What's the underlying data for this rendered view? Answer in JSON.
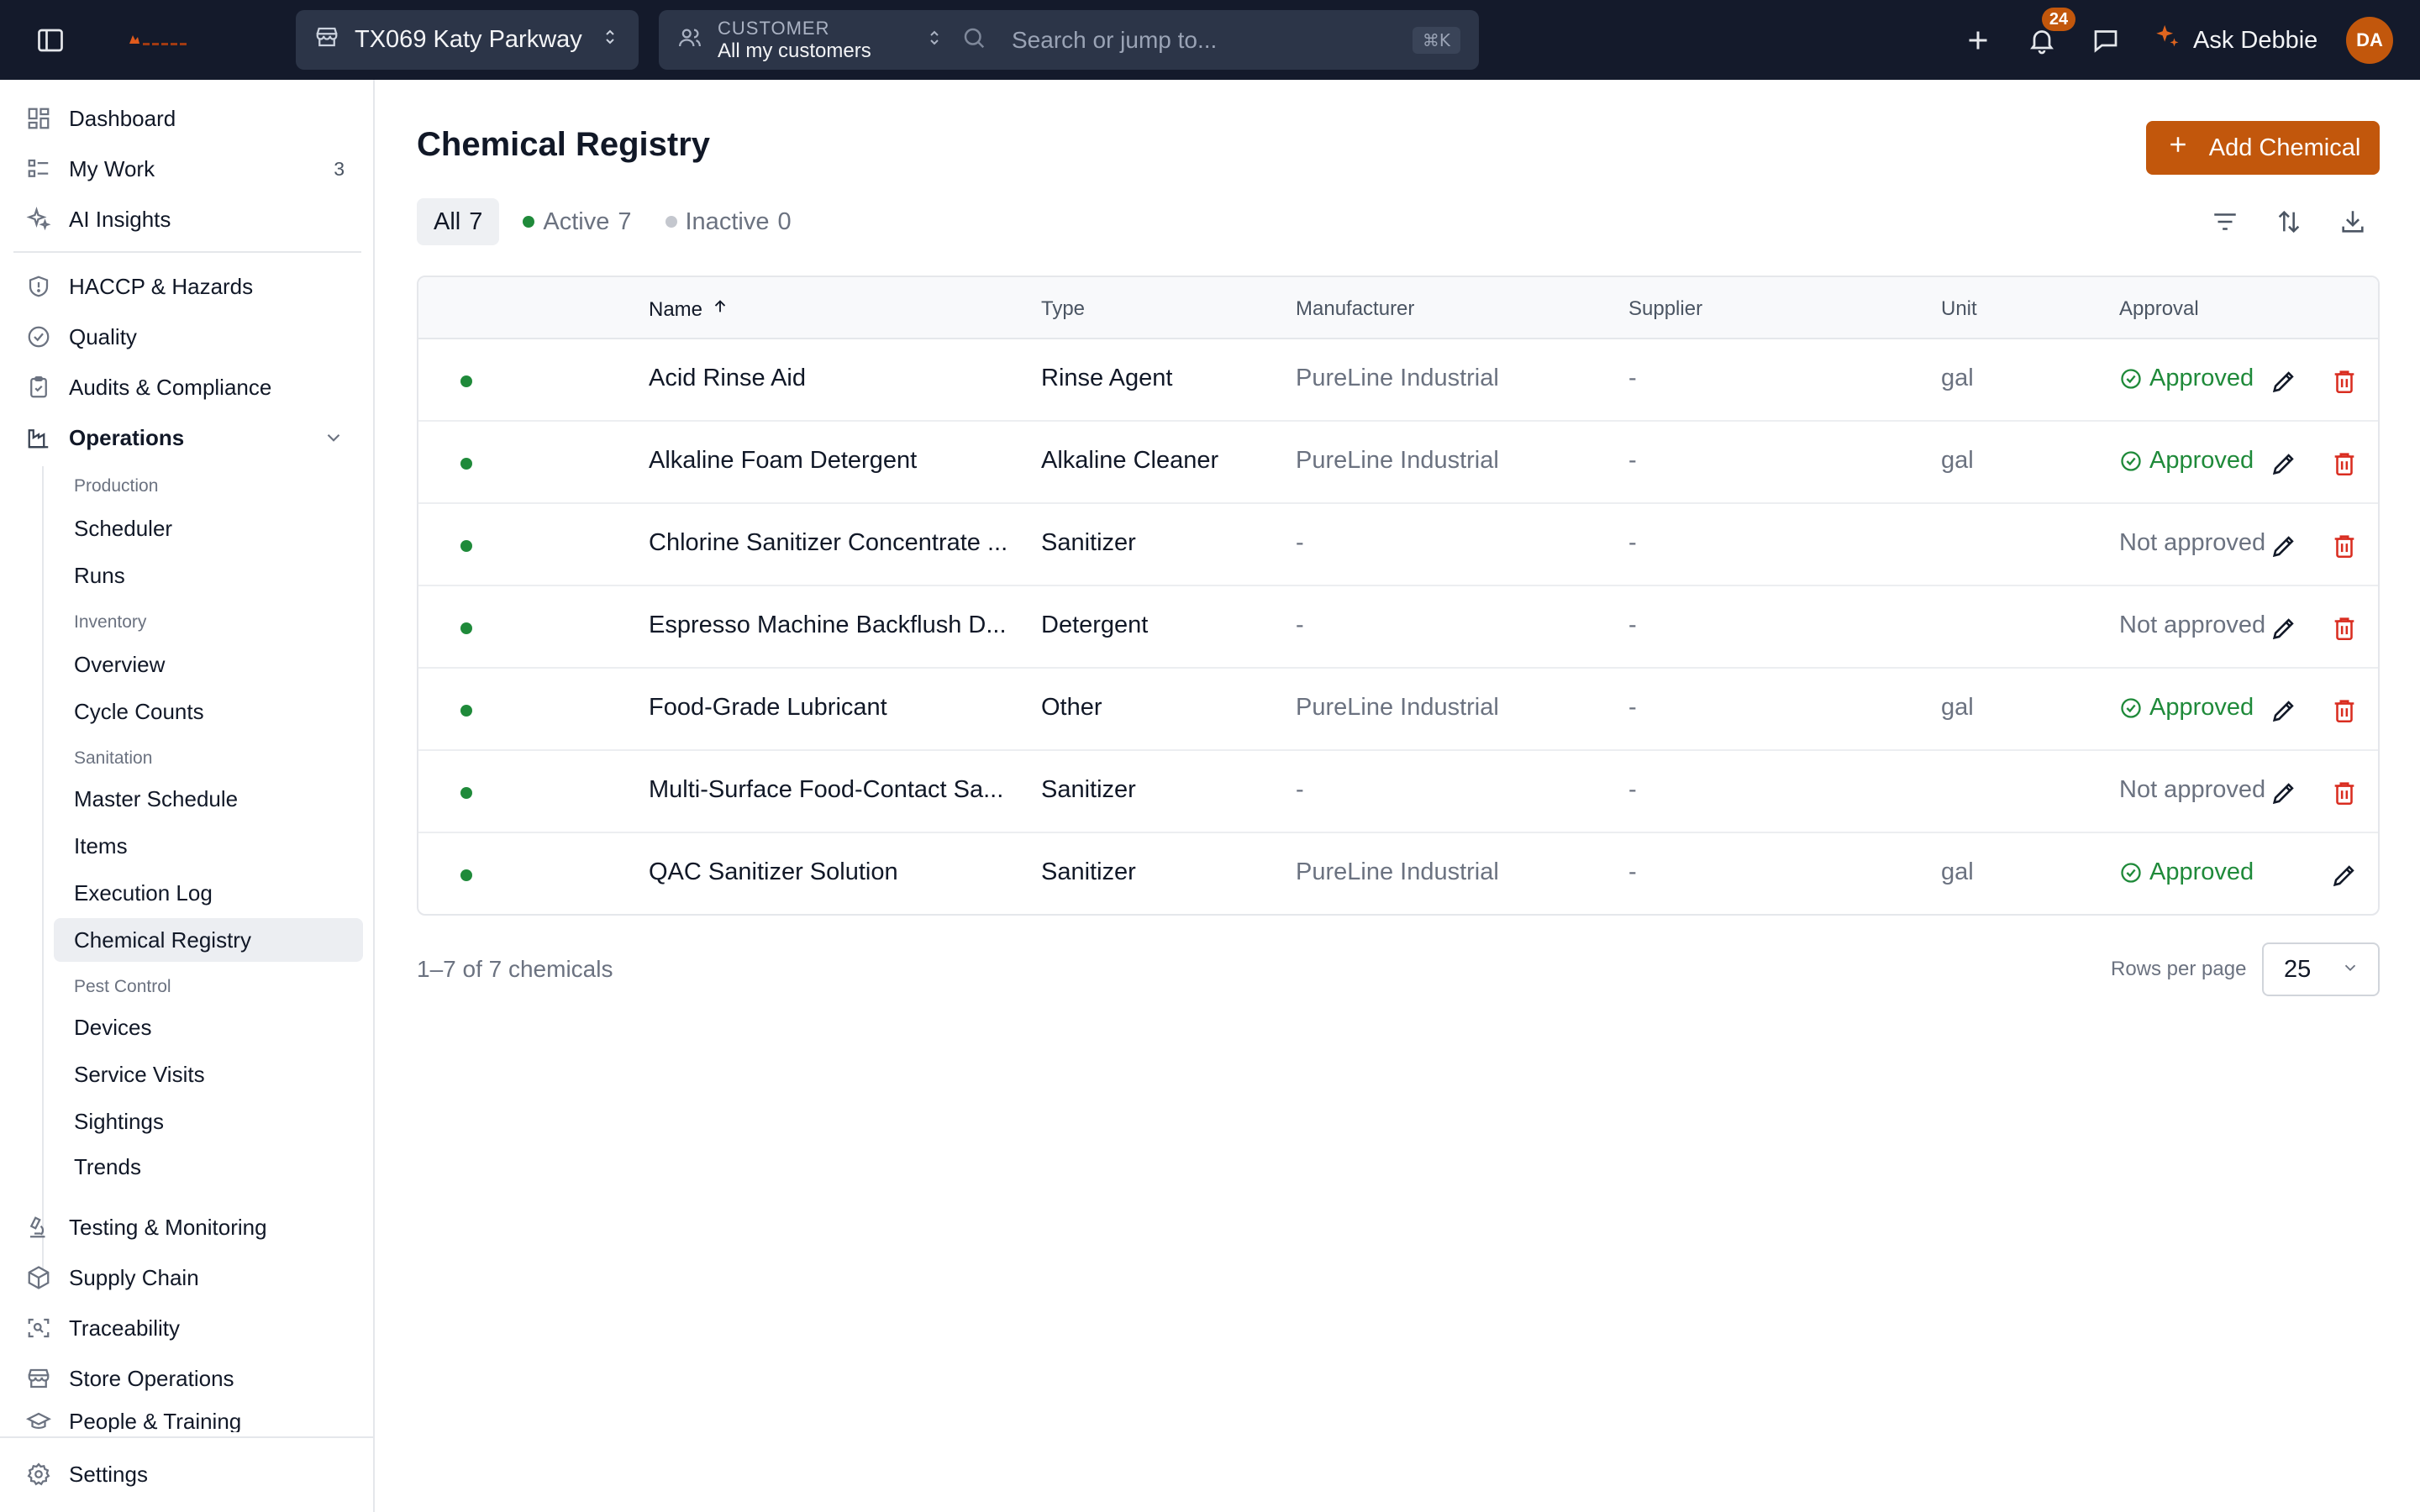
{
  "topbar": {
    "location": "TX069 Katy Parkway",
    "customer_caption": "CUSTOMER",
    "customer_value": "All my customers",
    "search_placeholder": "Search or jump to...",
    "search_shortcut": "⌘K",
    "notifications_count": "24",
    "ask_label": "Ask Debbie",
    "avatar_initials": "DA"
  },
  "sidebar": {
    "top_items": [
      {
        "label": "Dashboard",
        "icon": "dashboard-icon"
      },
      {
        "label": "My Work",
        "icon": "list-icon",
        "count": "3"
      },
      {
        "label": "AI Insights",
        "icon": "sparkle-icon"
      }
    ],
    "sections": [
      {
        "label": "HACCP & Hazards",
        "icon": "shield-icon"
      },
      {
        "label": "Quality",
        "icon": "check-circle-icon"
      },
      {
        "label": "Audits & Compliance",
        "icon": "clipboard-icon"
      },
      {
        "label": "Operations",
        "icon": "factory-icon"
      }
    ],
    "operations_groups": {
      "production": "Production",
      "production_items": [
        "Scheduler",
        "Runs"
      ],
      "inventory": "Inventory",
      "inventory_items": [
        "Overview",
        "Cycle Counts"
      ],
      "sanitation": "Sanitation",
      "sanitation_items": [
        "Master Schedule",
        "Items",
        "Execution Log",
        "Chemical Registry"
      ],
      "pest": "Pest Control",
      "pest_items": [
        "Devices",
        "Service Visits",
        "Sightings",
        "Trends"
      ]
    },
    "bottom_items": [
      {
        "label": "Testing & Monitoring",
        "icon": "microscope-icon"
      },
      {
        "label": "Supply Chain",
        "icon": "package-icon"
      },
      {
        "label": "Traceability",
        "icon": "scan-icon"
      },
      {
        "label": "Store Operations",
        "icon": "store-icon"
      },
      {
        "label": "People & Training",
        "icon": "graduation-cap-icon"
      }
    ],
    "settings": "Settings"
  },
  "main": {
    "title": "Chemical Registry",
    "add_button": "Add Chemical",
    "tabs": [
      {
        "label": "All",
        "count": "7"
      },
      {
        "label": "Active",
        "count": "7"
      },
      {
        "label": "Inactive",
        "count": "0"
      }
    ],
    "columns": {
      "name": "Name",
      "type": "Type",
      "manufacturer": "Manufacturer",
      "supplier": "Supplier",
      "unit": "Unit",
      "approval": "Approval"
    },
    "rows": [
      {
        "name": "Acid Rinse Aid",
        "type": "Rinse Agent",
        "manufacturer": "PureLine Industrial",
        "supplier": "-",
        "unit": "gal",
        "approval": "Approved"
      },
      {
        "name": "Alkaline Foam Detergent",
        "type": "Alkaline Cleaner",
        "manufacturer": "PureLine Industrial",
        "supplier": "-",
        "unit": "gal",
        "approval": "Approved"
      },
      {
        "name": "Chlorine Sanitizer Concentrate ...",
        "type": "Sanitizer",
        "manufacturer": "-",
        "supplier": "-",
        "unit": "",
        "approval": "Not approved"
      },
      {
        "name": "Espresso Machine Backflush D...",
        "type": "Detergent",
        "manufacturer": "-",
        "supplier": "-",
        "unit": "",
        "approval": "Not approved"
      },
      {
        "name": "Food-Grade Lubricant",
        "type": "Other",
        "manufacturer": "PureLine Industrial",
        "supplier": "-",
        "unit": "gal",
        "approval": "Approved"
      },
      {
        "name": "Multi-Surface Food-Contact Sa...",
        "type": "Sanitizer",
        "manufacturer": "-",
        "supplier": "-",
        "unit": "",
        "approval": "Not approved"
      },
      {
        "name": "QAC Sanitizer Solution",
        "type": "Sanitizer",
        "manufacturer": "PureLine Industrial",
        "supplier": "-",
        "unit": "gal",
        "approval": "Approved"
      }
    ],
    "footer_range": "1–7 of 7 chemicals",
    "rows_per_page_label": "Rows per page",
    "rows_per_page_value": "25"
  },
  "colors": {
    "topbar_bg": "#141a2b",
    "accent": "#c2570c",
    "approved": "#1f8a3a",
    "delete": "#d92d20",
    "active_dot": "#1f8a3a",
    "inactive_dot": "#c4c7ce"
  }
}
